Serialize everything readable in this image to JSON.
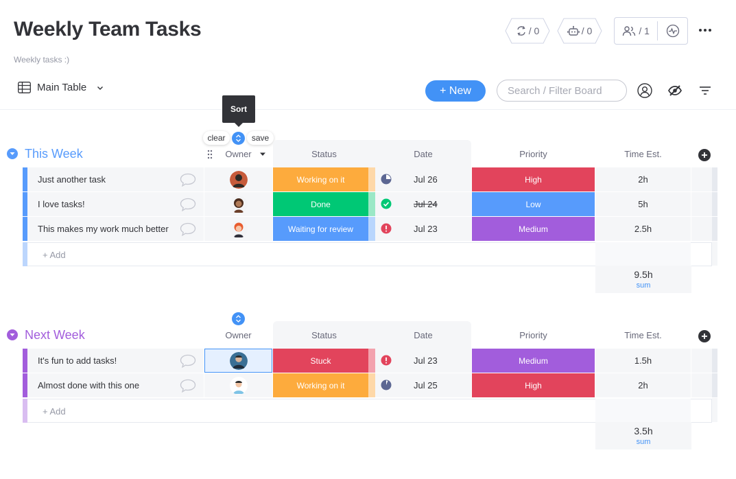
{
  "board": {
    "title": "Weekly Team Tasks",
    "description": "Weekly tasks :)"
  },
  "header": {
    "automations_count": "/ 0",
    "integrations_count": "/ 0",
    "members_count": "/ 1"
  },
  "toolbar": {
    "view_label": "Main Table",
    "new_label": "+ New",
    "search_placeholder": "Search / Filter Board"
  },
  "sort_tooltip": {
    "label": "Sort",
    "clear": "clear",
    "save": "save"
  },
  "columns": {
    "owner": "Owner",
    "status": "Status",
    "date": "Date",
    "priority": "Priority",
    "time": "Time Est."
  },
  "colors": {
    "blue_group": "#579bfc",
    "purple_group": "#a25ddc",
    "working": "#fdab3d",
    "done": "#00c875",
    "review": "#579bfc",
    "stuck": "#e2445c",
    "high": "#e2445c",
    "low": "#579bfc",
    "medium": "#a25ddc"
  },
  "groups": [
    {
      "title": "This Week",
      "add_label": "+ Add",
      "sum_value": "9.5h",
      "sum_label": "sum",
      "rows": [
        {
          "name": "Just another task",
          "status": "Working on it",
          "date": "Jul 26",
          "priority": "High",
          "time": "2h"
        },
        {
          "name": "I love tasks!",
          "status": "Done",
          "date": "Jul 24",
          "priority": "Low",
          "time": "5h"
        },
        {
          "name": "This makes my work much better",
          "status": "Waiting for review",
          "date": "Jul 23",
          "priority": "Medium",
          "time": "2.5h"
        }
      ]
    },
    {
      "title": "Next Week",
      "add_label": "+ Add",
      "sum_value": "3.5h",
      "sum_label": "sum",
      "rows": [
        {
          "name": "It's fun to add tasks!",
          "status": "Stuck",
          "date": "Jul 23",
          "priority": "Medium",
          "time": "1.5h"
        },
        {
          "name": "Almost done with this one",
          "status": "Working on it",
          "date": "Jul 25",
          "priority": "High",
          "time": "2h"
        }
      ]
    }
  ]
}
